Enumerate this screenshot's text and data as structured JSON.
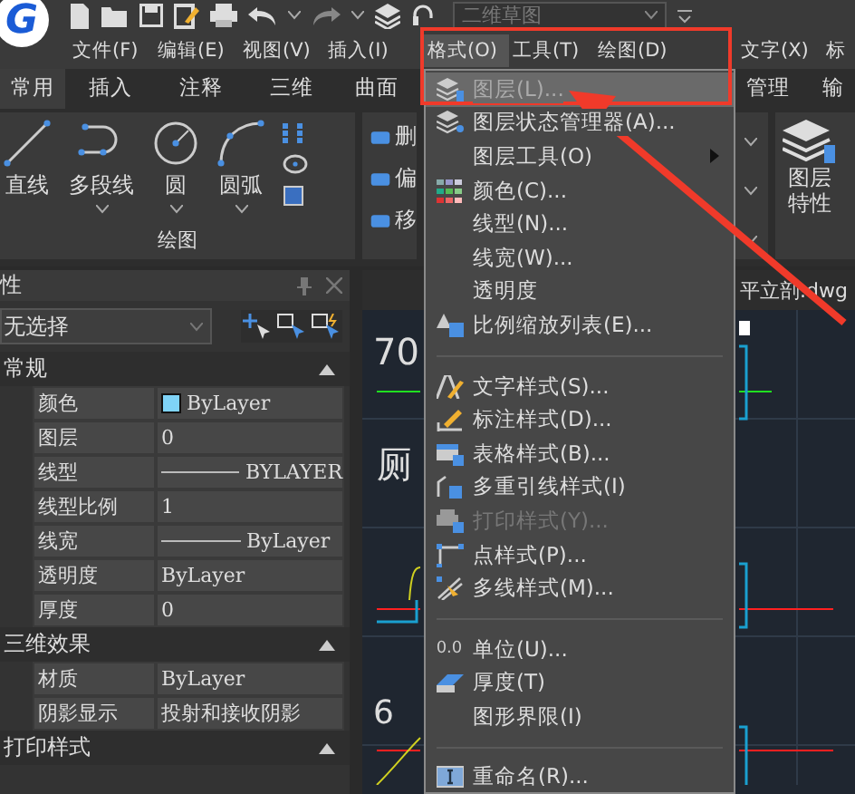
{
  "logo_letter": "G",
  "workspace": "二维草图",
  "menu_bar": [
    {
      "label": "文件(F)",
      "selected": false
    },
    {
      "label": "编辑(E)",
      "selected": false
    },
    {
      "label": "视图(V)",
      "selected": false
    },
    {
      "label": "插入(I)",
      "selected": false
    },
    {
      "label": "格式(O)",
      "selected": true
    },
    {
      "label": "工具(T)",
      "selected": false
    },
    {
      "label": "绘图(D)",
      "selected": false
    },
    {
      "label": "文字(X)",
      "selected": false
    },
    {
      "label": "标",
      "selected": false
    }
  ],
  "ribbon_tabs": [
    {
      "label": "常用",
      "selected": true
    },
    {
      "label": "插入",
      "selected": false
    },
    {
      "label": "注释",
      "selected": false
    },
    {
      "label": "三维",
      "selected": false
    },
    {
      "label": "曲面",
      "selected": false
    },
    {
      "label": "管理",
      "selected": false
    },
    {
      "label": "输",
      "selected": false
    }
  ],
  "ribbon": {
    "draw_tools": [
      {
        "label": "直线",
        "kind": "line"
      },
      {
        "label": "多段线",
        "kind": "polyline"
      },
      {
        "label": "圆",
        "kind": "circle"
      },
      {
        "label": "圆弧",
        "kind": "arc"
      }
    ],
    "draw_group_label": "绘图",
    "modify_tools": [
      "删",
      "偏",
      "移"
    ],
    "layer_button": "图层特性"
  },
  "properties_panel": {
    "title": "性",
    "selection": "无选择",
    "sections": [
      {
        "title": "常规",
        "expanded": true,
        "rows": [
          {
            "label": "颜色",
            "value": "ByLayer",
            "kind": "color",
            "color": "#7fd3f7"
          },
          {
            "label": "图层",
            "value": "0",
            "kind": "text"
          },
          {
            "label": "线型",
            "value": "BYLAYER",
            "kind": "line"
          },
          {
            "label": "线型比例",
            "value": "1",
            "kind": "text"
          },
          {
            "label": "线宽",
            "value": "ByLayer",
            "kind": "line"
          },
          {
            "label": "透明度",
            "value": "ByLayer",
            "kind": "text"
          },
          {
            "label": "厚度",
            "value": "0",
            "kind": "text"
          }
        ]
      },
      {
        "title": "三维效果",
        "expanded": true,
        "rows": [
          {
            "label": "材质",
            "value": "ByLayer",
            "kind": "text"
          },
          {
            "label": "阴影显示",
            "value": "投射和接收阴影",
            "kind": "text"
          }
        ]
      },
      {
        "title": "打印样式",
        "expanded": true
      }
    ]
  },
  "drawing": {
    "file_tab": "平立剖.dwg",
    "texts": [
      "70",
      "厕",
      "6"
    ]
  },
  "format_menu": {
    "groups": [
      [
        {
          "label": "图层(L)...",
          "selected": true,
          "disabled": false,
          "submenu": false
        },
        {
          "label": "图层状态管理器(A)...",
          "selected": false,
          "disabled": false,
          "submenu": false
        },
        {
          "label": "图层工具(O)",
          "selected": false,
          "disabled": false,
          "submenu": true
        },
        {
          "label": "颜色(C)...",
          "selected": false,
          "disabled": false,
          "submenu": false
        },
        {
          "label": "线型(N)...",
          "selected": false,
          "disabled": false,
          "submenu": false
        },
        {
          "label": "线宽(W)...",
          "selected": false,
          "disabled": false,
          "submenu": false
        },
        {
          "label": "透明度",
          "selected": false,
          "disabled": false,
          "submenu": false
        },
        {
          "label": "比例缩放列表(E)...",
          "selected": false,
          "disabled": false,
          "submenu": false
        }
      ],
      [
        {
          "label": "文字样式(S)...",
          "selected": false,
          "disabled": false,
          "submenu": false
        },
        {
          "label": "标注样式(D)...",
          "selected": false,
          "disabled": false,
          "submenu": false
        },
        {
          "label": "表格样式(B)...",
          "selected": false,
          "disabled": false,
          "submenu": false
        },
        {
          "label": "多重引线样式(I)",
          "selected": false,
          "disabled": false,
          "submenu": false
        },
        {
          "label": "打印样式(Y)...",
          "selected": false,
          "disabled": true,
          "submenu": false
        },
        {
          "label": "点样式(P)...",
          "selected": false,
          "disabled": false,
          "submenu": false
        },
        {
          "label": "多线样式(M)...",
          "selected": false,
          "disabled": false,
          "submenu": false
        }
      ],
      [
        {
          "label": "单位(U)...",
          "icon_text": "0.0",
          "selected": false,
          "disabled": false,
          "submenu": false
        },
        {
          "label": "厚度(T)",
          "selected": false,
          "disabled": false,
          "submenu": false
        },
        {
          "label": "图形界限(I)",
          "selected": false,
          "disabled": false,
          "submenu": false
        }
      ],
      [
        {
          "label": "重命名(R)...",
          "selected": false,
          "disabled": false,
          "submenu": false
        }
      ]
    ]
  }
}
